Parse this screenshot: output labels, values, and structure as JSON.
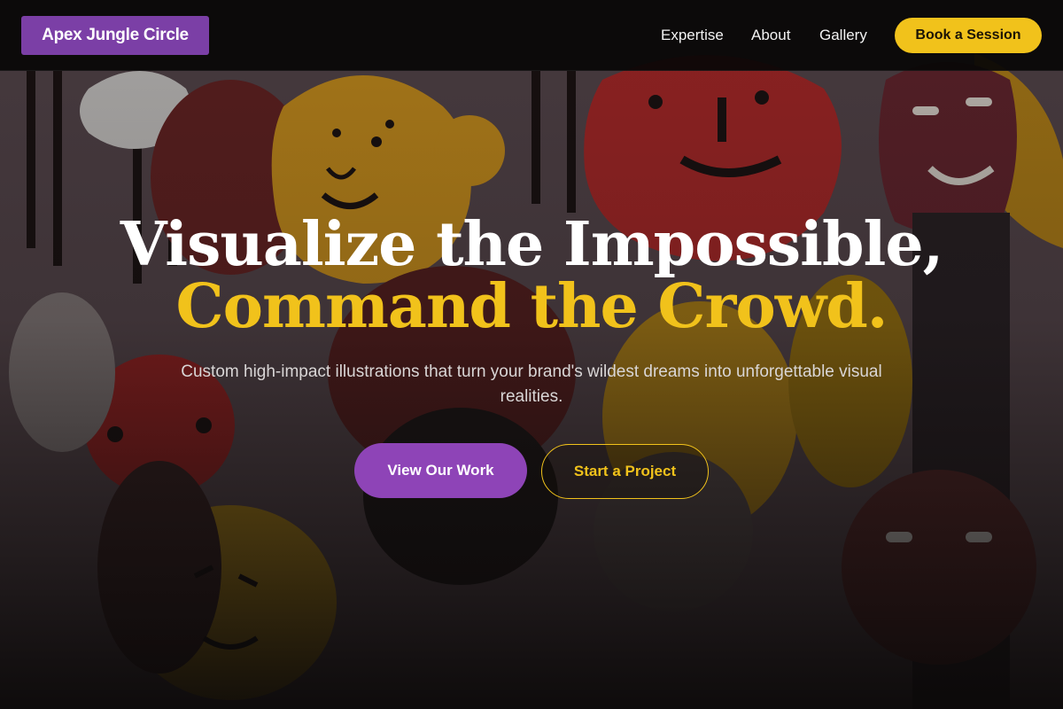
{
  "nav": {
    "logo": "Apex Jungle Circle",
    "links": [
      "Expertise",
      "About",
      "Gallery"
    ],
    "cta": "Book a Session"
  },
  "hero": {
    "headline_line1": "Visualize the Impossible,",
    "headline_line2": "Command the Crowd.",
    "subtext": "Custom high-impact illustrations that turn your brand's wildest dreams into unforgettable visual realities.",
    "primary_button": "View Our Work",
    "secondary_button": "Start a Project",
    "background_image": "illustrated-faces-mural"
  },
  "colors": {
    "brand_purple": "#7b3fa6",
    "button_purple": "#8e44b7",
    "accent_yellow": "#f1c21b",
    "nav_background": "#080606"
  }
}
